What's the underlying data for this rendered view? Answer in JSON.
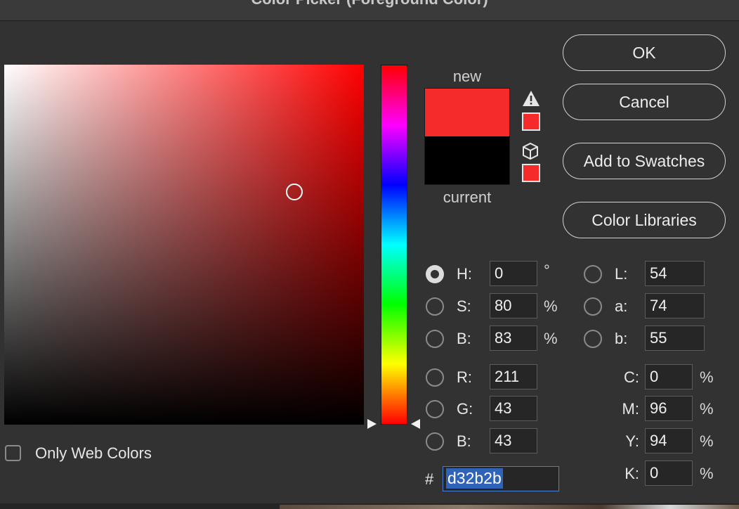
{
  "window": {
    "title": "Color Picker (Foreground Color)"
  },
  "colors": {
    "new_color": "#f52a2a",
    "current_color": "#000000",
    "gamut_swatch": "#f52a2a",
    "web_swatch": "#f52a2a",
    "accent": "#2f63b8"
  },
  "picker": {
    "hue_icon_left": "triangle-right-icon",
    "hue_icon_right": "triangle-left-icon",
    "marker": "circle-marker",
    "new_label": "new",
    "current_label": "current",
    "warnings": {
      "gamut_icon": "warning-triangle-icon",
      "web_icon": "cube-icon"
    }
  },
  "buttons": {
    "ok": "OK",
    "cancel": "Cancel",
    "add_to_swatches": "Add to Swatches",
    "color_libraries": "Color Libraries"
  },
  "hsb": {
    "h_label": "H:",
    "h_value": "0",
    "h_unit": "°",
    "s_label": "S:",
    "s_value": "80",
    "s_unit": "%",
    "b_label": "B:",
    "b_value": "83",
    "b_unit": "%"
  },
  "rgb": {
    "r_label": "R:",
    "r_value": "211",
    "g_label": "G:",
    "g_value": "43",
    "b_label": "B:",
    "b_value": "43"
  },
  "lab": {
    "l_label": "L:",
    "l_value": "54",
    "a_label": "a:",
    "a_value": "74",
    "b_label": "b:",
    "b_value": "55"
  },
  "cmyk": {
    "c_label": "C:",
    "c_value": "0",
    "c_unit": "%",
    "m_label": "M:",
    "m_value": "96",
    "m_unit": "%",
    "y_label": "Y:",
    "y_value": "94",
    "y_unit": "%",
    "k_label": "K:",
    "k_value": "0",
    "k_unit": "%"
  },
  "hex": {
    "label": "#",
    "value": "d32b2b"
  },
  "options": {
    "only_web_colors": "Only Web Colors",
    "only_web_colors_checked": false
  }
}
